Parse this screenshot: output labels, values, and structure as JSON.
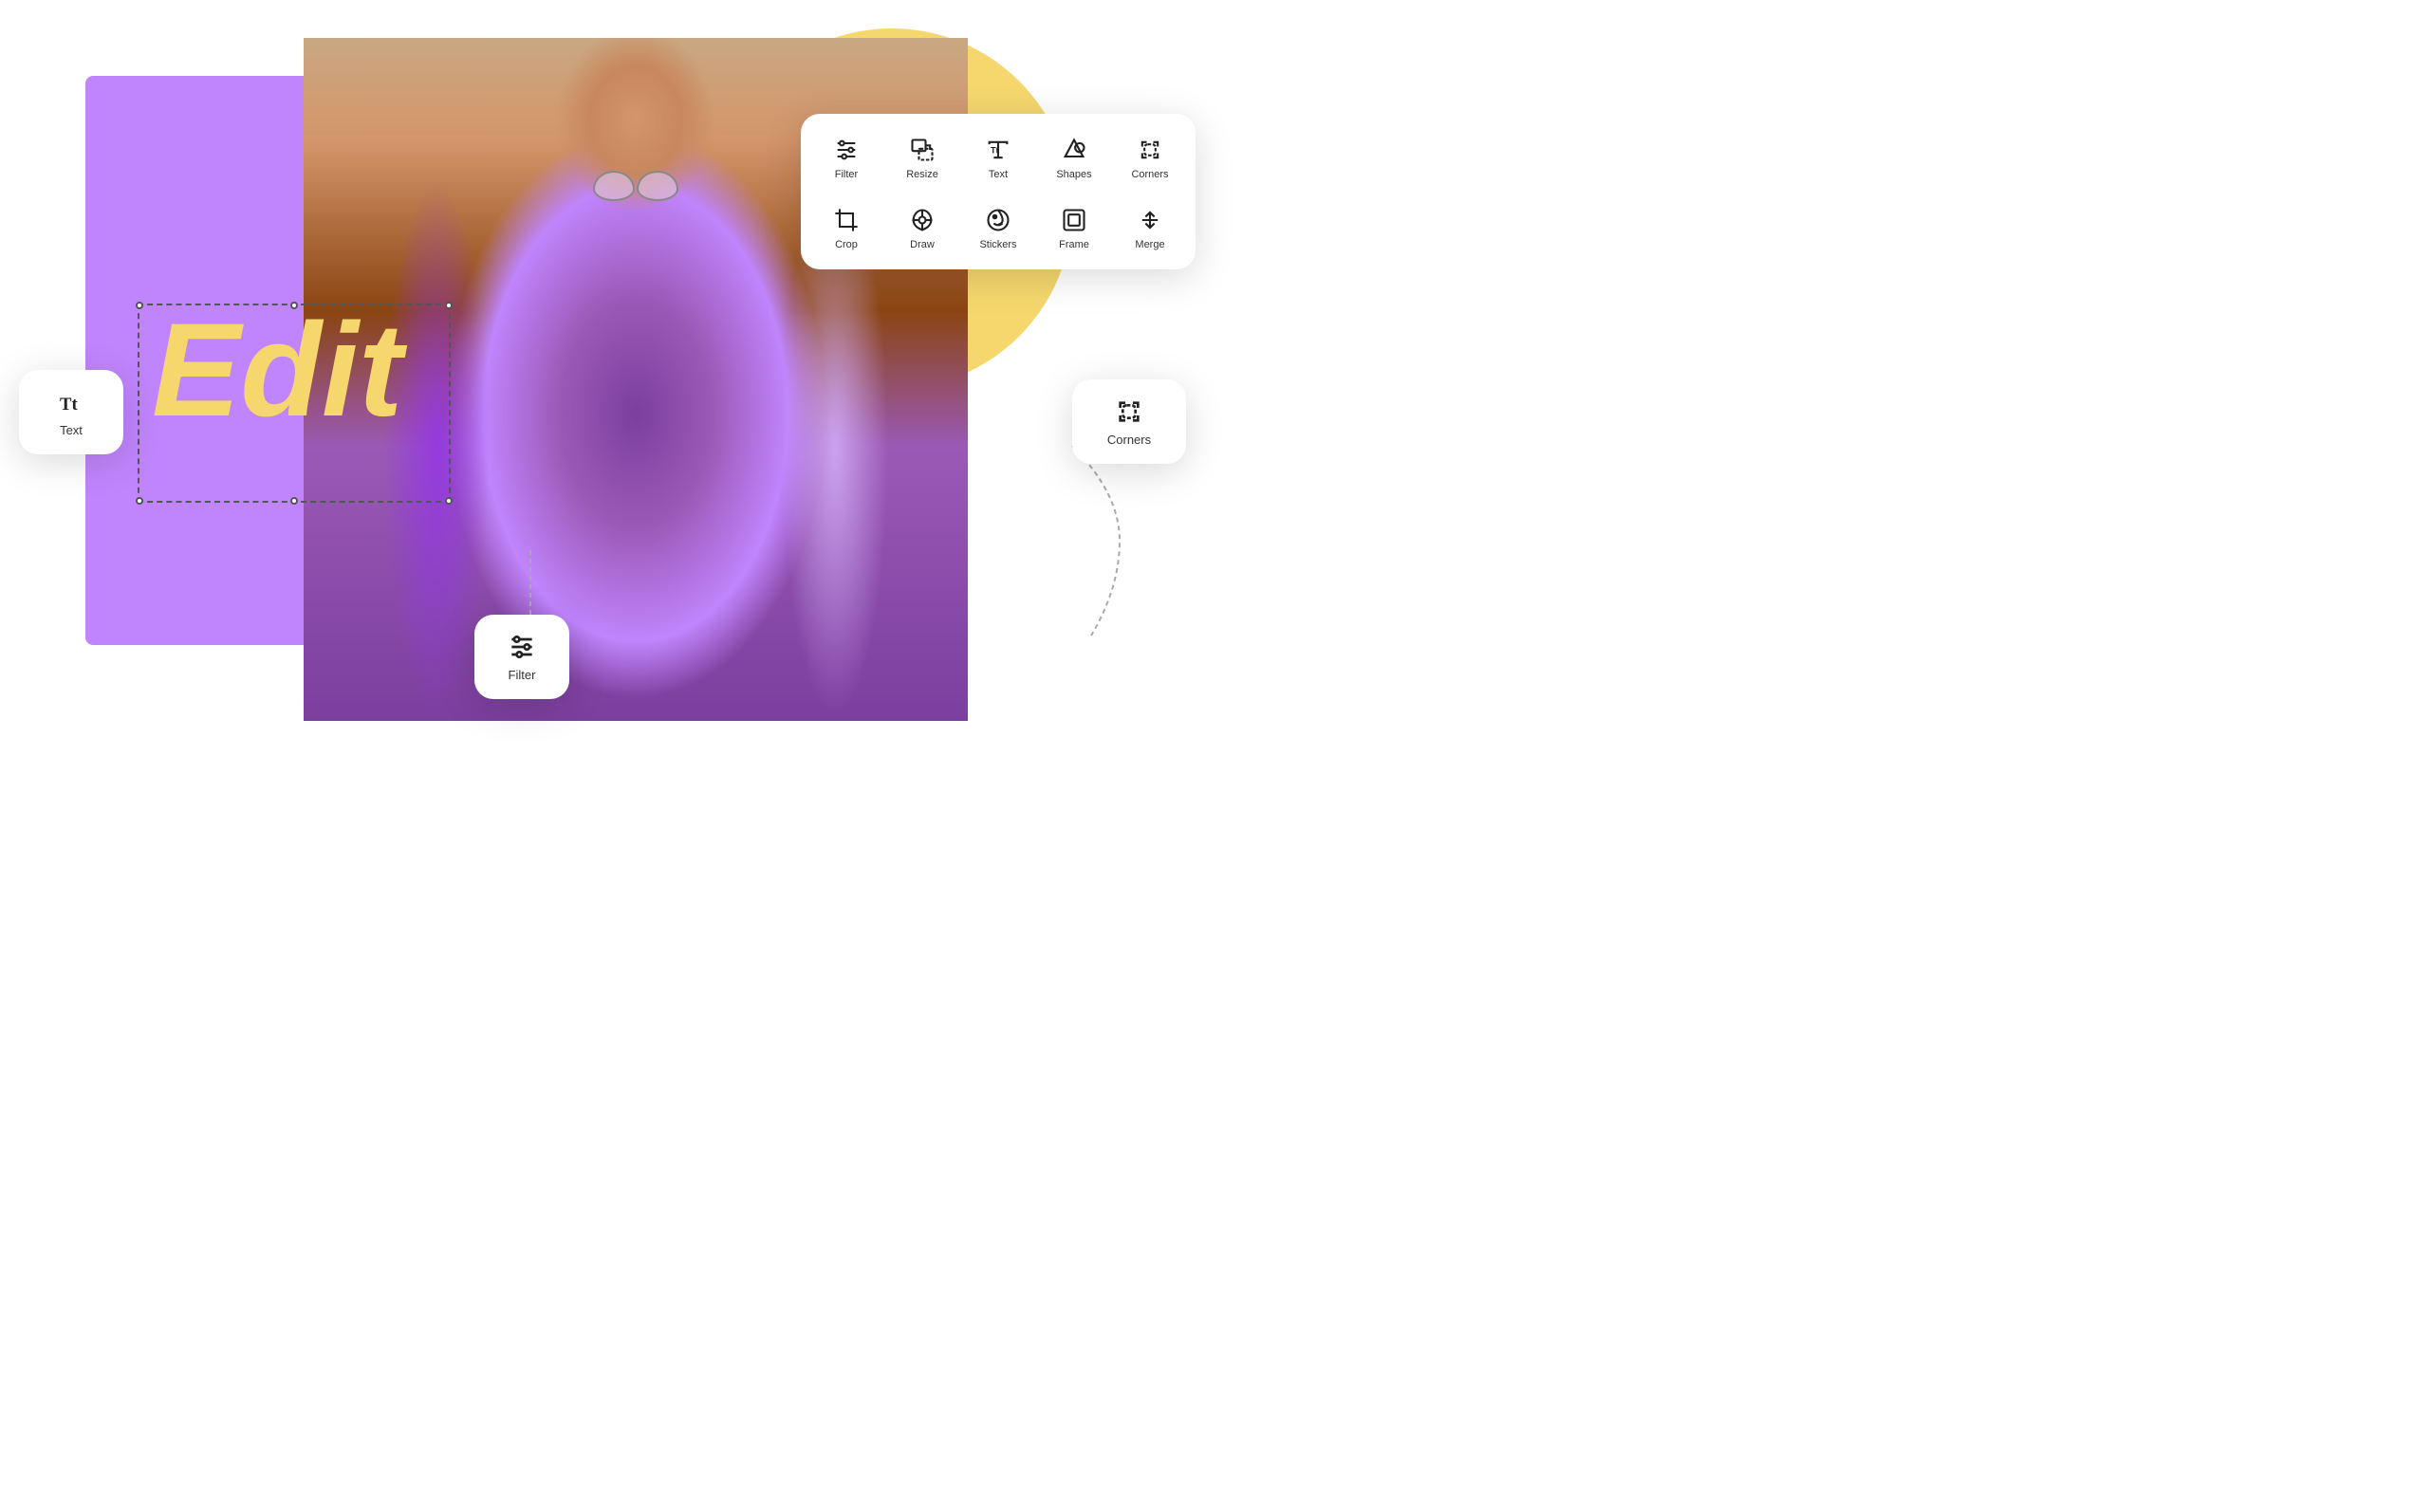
{
  "background": {
    "yellow_circle_color": "#F5D76E"
  },
  "canvas": {
    "background_color": "#C084FC",
    "edit_text": "Edit",
    "edit_text_color": "#F5D76E"
  },
  "toolbar": {
    "items": [
      {
        "id": "filter",
        "label": "Filter",
        "icon": "filter-icon"
      },
      {
        "id": "resize",
        "label": "Resize",
        "icon": "resize-icon"
      },
      {
        "id": "text",
        "label": "Text",
        "icon": "text-icon"
      },
      {
        "id": "shapes",
        "label": "Shapes",
        "icon": "shapes-icon"
      },
      {
        "id": "corners",
        "label": "Corners",
        "icon": "corners-icon"
      },
      {
        "id": "crop",
        "label": "Crop",
        "icon": "crop-icon"
      },
      {
        "id": "draw",
        "label": "Draw",
        "icon": "draw-icon"
      },
      {
        "id": "stickers",
        "label": "Stickers",
        "icon": "stickers-icon"
      },
      {
        "id": "frame",
        "label": "Frame",
        "icon": "frame-icon"
      },
      {
        "id": "merge",
        "label": "Merge",
        "icon": "merge-icon"
      }
    ]
  },
  "floating_text_card": {
    "label": "Text",
    "icon": "text-icon"
  },
  "floating_filter_card": {
    "label": "Filter",
    "icon": "filter-icon"
  },
  "floating_corners_card": {
    "label": "Corners",
    "icon": "corners-icon"
  }
}
